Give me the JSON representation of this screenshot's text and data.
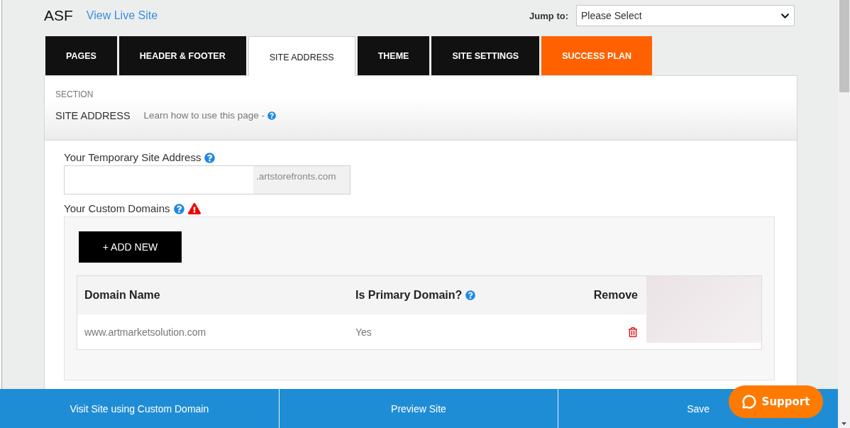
{
  "header": {
    "title": "ASF",
    "link": "View Live Site",
    "jump_to": {
      "label": "Jump to:",
      "value": "Please Select"
    }
  },
  "tabs": [
    {
      "label": "PAGES",
      "selected": false,
      "kind": "standard"
    },
    {
      "label": "HEADER & FOOTER",
      "selected": false,
      "kind": "standard"
    },
    {
      "label": "SITE ADDRESS",
      "selected": true,
      "kind": "standard"
    },
    {
      "label": "THEME",
      "selected": false,
      "kind": "standard"
    },
    {
      "label": "SITE SETTINGS",
      "selected": false,
      "kind": "standard"
    },
    {
      "label": "SUCCESS PLAN",
      "selected": false,
      "kind": "promo"
    }
  ],
  "section": {
    "caption": "SECTION",
    "title": "SITE ADDRESS",
    "help_link": "Learn how to use this page -"
  },
  "temporary_address": {
    "label": "Your Temporary Site Address",
    "suffix": ".artstorefronts.com"
  },
  "custom_domains": {
    "label": "Your Custom Domains",
    "warning": true,
    "add_button": "+ ADD NEW",
    "columns": [
      {
        "label": "Domain Name",
        "help": false
      },
      {
        "label": "Is Primary Domain?",
        "help": true
      },
      {
        "label": "Remove",
        "help": false
      }
    ],
    "rows": [
      {
        "domain": "www.artmarketsolution.com",
        "primary": "Yes"
      }
    ]
  },
  "footer_buttons": [
    "Visit Site using Custom Domain",
    "Preview Site",
    "Save"
  ],
  "support": "Support"
}
